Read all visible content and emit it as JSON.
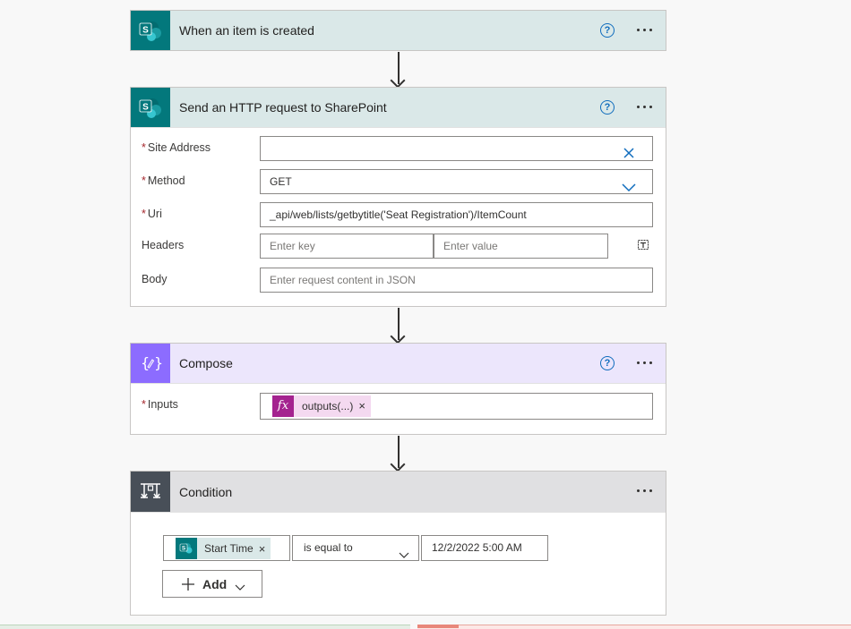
{
  "trigger": {
    "title": "When an item is created"
  },
  "http": {
    "title": "Send an HTTP request to SharePoint",
    "site_address": {
      "label": "Site Address",
      "value": ""
    },
    "method": {
      "label": "Method",
      "value": "GET"
    },
    "uri": {
      "label": "Uri",
      "value": "_api/web/lists/getbytitle('Seat Registration')/ItemCount"
    },
    "headers": {
      "label": "Headers",
      "key_placeholder": "Enter key",
      "value_placeholder": "Enter value"
    },
    "body": {
      "label": "Body",
      "placeholder": "Enter request content in JSON"
    }
  },
  "compose": {
    "title": "Compose",
    "inputs": {
      "label": "Inputs",
      "token": "outputs(...)"
    }
  },
  "condition": {
    "title": "Condition",
    "left_token": "Start Time",
    "operator": "is equal to",
    "right_value": "12/2/2022 5:00 AM",
    "add_label": "Add"
  },
  "help_glyph": "?",
  "required_mark": "*",
  "remove_glyph": "×",
  "sp_letter": "S",
  "colors": {
    "sharepoint": "#03787c",
    "compose": "#8c6cff",
    "condition": "#484f58",
    "expression": "#a4238f"
  }
}
